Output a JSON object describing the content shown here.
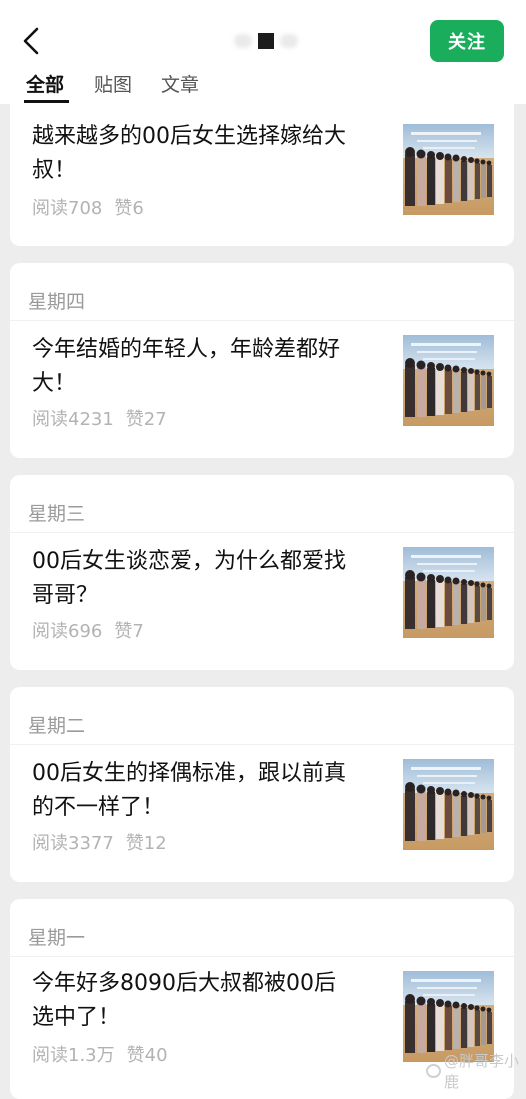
{
  "header": {
    "follow_label": "关注",
    "tabs": [
      {
        "label": "全部",
        "active": true
      },
      {
        "label": "贴图",
        "active": false
      },
      {
        "label": "文章",
        "active": false
      }
    ]
  },
  "articles": [
    {
      "day": "",
      "title_line1": "越来越多的00后女生选择嫁给大",
      "title_line2": "叔！",
      "reads": "阅读708",
      "likes": "赞6"
    },
    {
      "day": "星期四",
      "title_line1": "今年结婚的年轻人，年龄差都好",
      "title_line2": "大！",
      "reads": "阅读4231",
      "likes": "赞27"
    },
    {
      "day": "星期三",
      "title_line1": "00后女生谈恋爱，为什么都爱找",
      "title_line2": "哥哥？",
      "reads": "阅读696",
      "likes": "赞7"
    },
    {
      "day": "星期二",
      "title_line1": "00后女生的择偶标准，跟以前真",
      "title_line2": "的不一样了！",
      "reads": "阅读3377",
      "likes": "赞12"
    },
    {
      "day": "星期一",
      "title_line1": "今年好多8090后大叔都被00后",
      "title_line2": "选中了！",
      "reads": "阅读1.3万",
      "likes": "赞40"
    }
  ],
  "watermark": {
    "text": "@胖哥李小鹿"
  }
}
